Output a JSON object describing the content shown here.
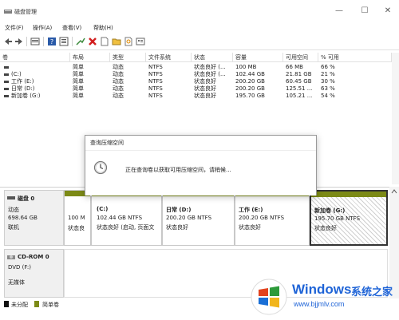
{
  "window": {
    "title": "磁盘管理",
    "controls": {
      "minimize": "—",
      "maximize": "☐",
      "close": "✕"
    }
  },
  "menu": [
    "文件(F)",
    "操作(A)",
    "查看(V)",
    "帮助(H)"
  ],
  "toolbar": {
    "icons": [
      "back-icon",
      "forward-icon",
      "disk-list-icon",
      "help-icon",
      "properties-icon",
      "connect-icon",
      "delete-icon",
      "blank-doc-icon",
      "folder-icon",
      "search-icon",
      "grid-icon"
    ]
  },
  "volume_table": {
    "columns": [
      "卷",
      "布局",
      "类型",
      "文件系统",
      "状态",
      "容量",
      "可用空间",
      "% 可用"
    ],
    "rows": [
      [
        "",
        "简单",
        "动态",
        "NTFS",
        "状态良好 (...",
        "100 MB",
        "66 MB",
        "66 %"
      ],
      [
        "(C:)",
        "简单",
        "动态",
        "NTFS",
        "状态良好 (...",
        "102.44 GB",
        "21.81 GB",
        "21 %"
      ],
      [
        "工作 (E:)",
        "简单",
        "动态",
        "NTFS",
        "状态良好",
        "200.20 GB",
        "60.45 GB",
        "30 %"
      ],
      [
        "日常 (D:)",
        "简单",
        "动态",
        "NTFS",
        "状态良好",
        "200.20 GB",
        "125.51 ...",
        "63 %"
      ],
      [
        "新加卷 (G:)",
        "简单",
        "动态",
        "NTFS",
        "状态良好",
        "195.70 GB",
        "105.21 ...",
        "54 %"
      ]
    ]
  },
  "dialog": {
    "title": "查询压缩空间",
    "message": "正在查询卷以获取可用压缩空间，请稍候..."
  },
  "disks": {
    "disk0": {
      "name": "磁盘 0",
      "type": "动态",
      "size": "698.64 GB",
      "status": "联机",
      "partitions": [
        {
          "name": "",
          "size": "100 M",
          "status": "状态良"
        },
        {
          "name": "(C:)",
          "size": "102.44 GB NTFS",
          "status": "状态良好 (启动, 页面文"
        },
        {
          "name": "日常  (D:)",
          "size": "200.20 GB NTFS",
          "status": "状态良好"
        },
        {
          "name": "工作  (E:)",
          "size": "200.20 GB NTFS",
          "status": "状态良好"
        },
        {
          "name": "新加卷  (G:)",
          "size": "195.70 GB NTFS",
          "status": "状态良好"
        }
      ]
    },
    "cdrom0": {
      "name": "CD-ROM 0",
      "drive": "DVD (F:)",
      "media": "无媒体"
    }
  },
  "legend": [
    {
      "label": "未分配",
      "color": "#111111"
    },
    {
      "label": "简单卷",
      "color": "#7c8a16"
    }
  ],
  "watermark": {
    "brand": "Windows",
    "cn": "系统之家",
    "url": "www.bjjmlv.com"
  },
  "colors": {
    "simple_volume": "#7c8a16",
    "selected_hatch": "#c8c8c8",
    "accent_blue": "#1f64d7"
  }
}
